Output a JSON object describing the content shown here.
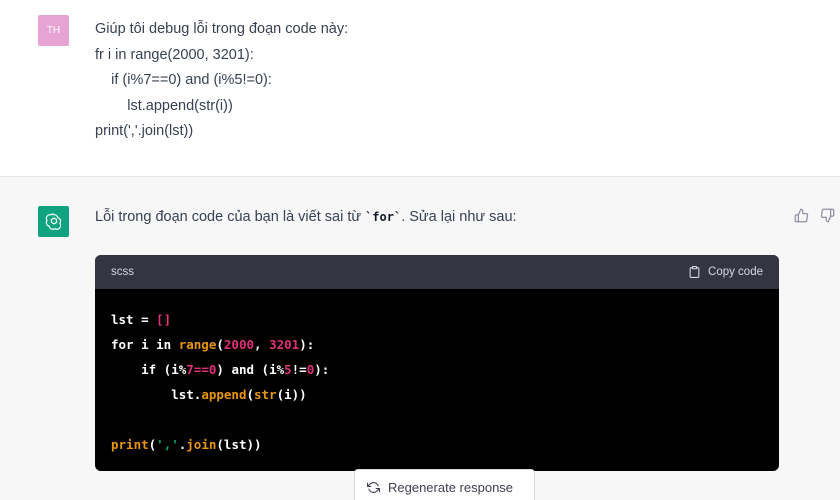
{
  "user": {
    "avatar_initials": "TH",
    "message_lines": [
      "Giúp tôi debug lỗi trong đoạn code này:",
      "fr i in range(2000, 3201):",
      "    if (i%7==0) and (i%5!=0):",
      "        lst.append(str(i))",
      "print(','.join(lst))"
    ]
  },
  "assistant": {
    "message_before": "Lỗi trong đoạn code của bạn là viết sai từ ",
    "message_code": "`for`",
    "message_after": ". Sửa lại như sau:",
    "code_block": {
      "language": "scss",
      "copy_label": "Copy code",
      "code_lst_var": "lst",
      "code_lst_eq": " = ",
      "code_brackets": "[]",
      "code_for_kw": "for i in ",
      "code_range_fn": "range",
      "code_open_paren": "(",
      "code_num_2000": "2000",
      "code_comma": ", ",
      "code_num_3201": "3201",
      "code_close_colon": "):",
      "code_if_indent": "    if (i%",
      "code_num_7": "7",
      "code_eq0": "==",
      "code_num_0a": "0",
      "code_and": ") and (i%",
      "code_num_5": "5",
      "code_neq": "!=",
      "code_num_0b": "0",
      "code_close2": "):",
      "code_append_indent": "        lst.",
      "code_append_fn": "append",
      "code_append_open": "(",
      "code_str_fn": "str",
      "code_append_tail": "(i))",
      "code_print_fn": "print",
      "code_print_open": "(",
      "code_str_lit": "','",
      "code_join": ".",
      "code_join_fn": "join",
      "code_join_tail": "(lst))"
    }
  },
  "regenerate_label": "Regenerate response",
  "colors": {
    "user_avatar": "#e7a3d4",
    "assistant_avatar": "#10a37f",
    "code_bg": "#000000",
    "code_header_bg": "#343541"
  }
}
